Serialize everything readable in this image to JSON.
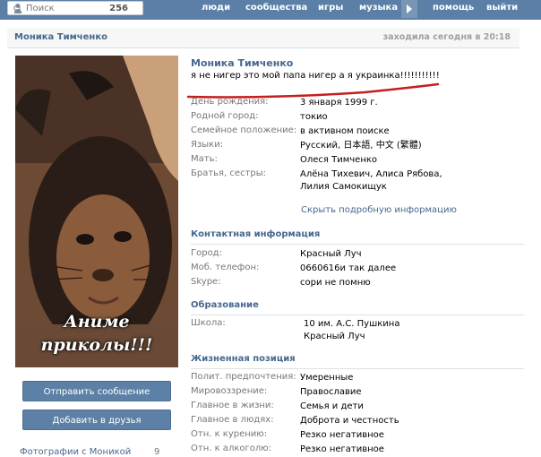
{
  "topbar": {
    "search_placeholder": "Поиск",
    "search_count": "256",
    "nav": [
      "люди",
      "сообщества",
      "игры",
      "музыка",
      "помощь",
      "выйти"
    ]
  },
  "header": {
    "name": "Моника Тимченко",
    "last_seen": "заходила сегодня в 20:18"
  },
  "photo_caption": [
    "Аниме",
    "приколы!!!"
  ],
  "buttons": {
    "send_message": "Отправить сообщение",
    "add_friend": "Добавить в друзья"
  },
  "photos": {
    "label": "Фотографии с Моникой",
    "count": "9"
  },
  "profile": {
    "name": "Моника Тимченко",
    "status": "я не нигер это мой папа нигер а я украинка!!!!!!!!!!!",
    "basic": [
      {
        "label": "День рождения:",
        "value": "3 января 1999 г."
      },
      {
        "label": "Родной город:",
        "value": "токио"
      },
      {
        "label": "Семейное положение:",
        "value": "в активном поиске"
      },
      {
        "label": "Языки:",
        "value": "Русский, 日本語, 中文 (繁體)"
      },
      {
        "label": "Мать:",
        "value": "Олеся Тимченко"
      },
      {
        "label": "Братья, сестры:",
        "value": "Алёна Тихевич, Алиса Рябова, Лилия Самокищук"
      }
    ],
    "show_more": "Скрыть подробную информацию",
    "contact_title": "Контактная информация",
    "contacts": [
      {
        "label": "Город:",
        "value": "Красный Луч"
      },
      {
        "label": "Моб. телефон:",
        "value": "0660616и так далее"
      },
      {
        "label": "Skype:",
        "value": "сори не помню"
      }
    ],
    "education_title": "Образование",
    "education": [
      {
        "label": "Школа:",
        "value": "10 им. А.С. Пушкина"
      },
      {
        "label": "",
        "value": "Красный Луч"
      }
    ],
    "life_title": "Жизненная позиция",
    "life": [
      {
        "label": "Полит. предпочтения:",
        "value": "Умеренные"
      },
      {
        "label": "Мировоззрение:",
        "value": "Православие"
      },
      {
        "label": "Главное в жизни:",
        "value": "Семья и дети"
      },
      {
        "label": "Главное в людях:",
        "value": "Доброта и честность"
      },
      {
        "label": "Отн. к курению:",
        "value": "Резко негативное"
      },
      {
        "label": "Отн. к алкоголю:",
        "value": "Резко негативное"
      }
    ]
  },
  "colors": {
    "topbar": "#5b7fa6",
    "link": "#45688e",
    "annotation": "#c41e1e"
  }
}
